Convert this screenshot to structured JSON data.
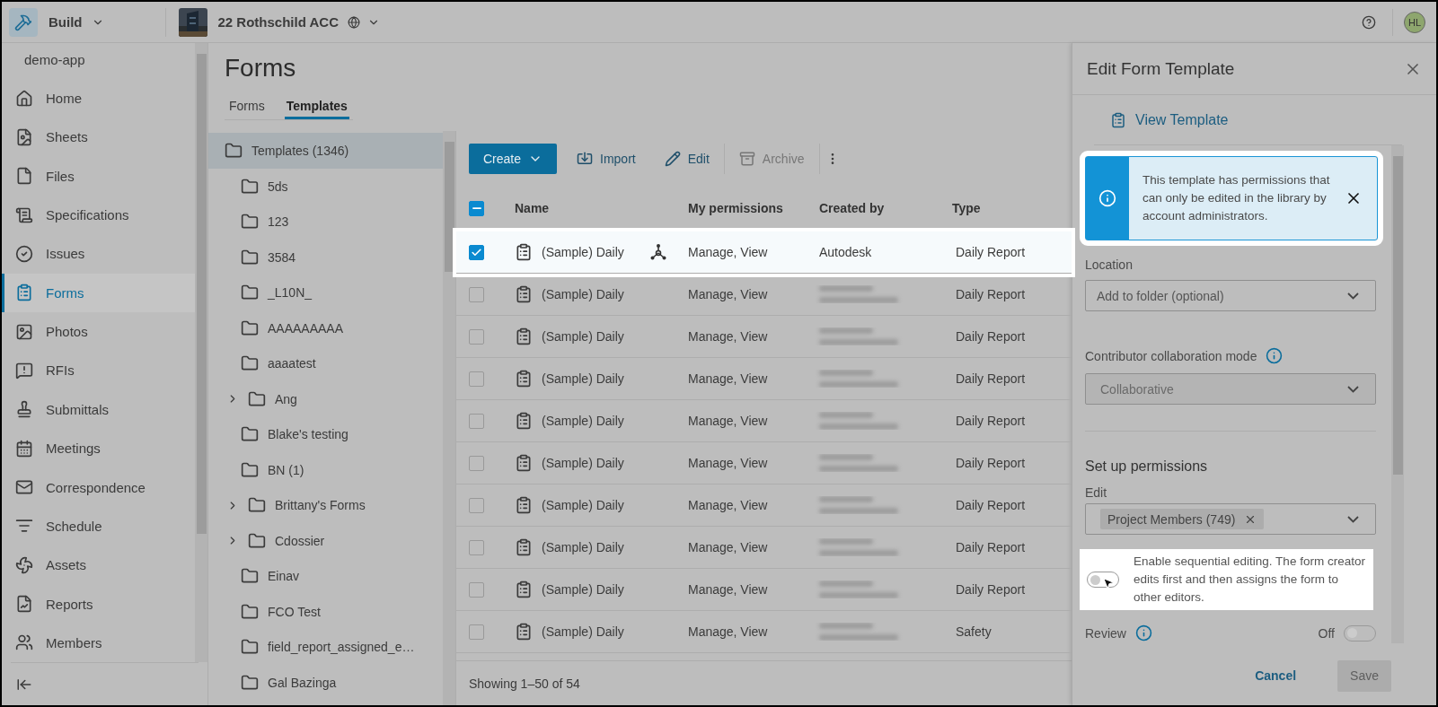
{
  "top_bar": {
    "app": "Build",
    "project": "22 Rothschild ACC",
    "avatar": "HL"
  },
  "sidebar": {
    "account": "demo-app",
    "items": [
      {
        "label": "Home",
        "selected": false
      },
      {
        "label": "Sheets",
        "selected": false
      },
      {
        "label": "Files",
        "selected": false
      },
      {
        "label": "Specifications",
        "selected": false
      },
      {
        "label": "Issues",
        "selected": false
      },
      {
        "label": "Forms",
        "selected": true
      },
      {
        "label": "Photos",
        "selected": false
      },
      {
        "label": "RFIs",
        "selected": false
      },
      {
        "label": "Submittals",
        "selected": false
      },
      {
        "label": "Meetings",
        "selected": false
      },
      {
        "label": "Correspondence",
        "selected": false
      },
      {
        "label": "Schedule",
        "selected": false
      },
      {
        "label": "Assets",
        "selected": false
      },
      {
        "label": "Reports",
        "selected": false
      },
      {
        "label": "Members",
        "selected": false
      }
    ]
  },
  "page": {
    "title": "Forms",
    "tabs": [
      {
        "label": "Forms",
        "selected": false
      },
      {
        "label": "Templates",
        "selected": true
      }
    ]
  },
  "tree": {
    "root": {
      "label": "Templates (1346)",
      "selected": true
    },
    "children": [
      {
        "label": "5ds",
        "collapsed": false
      },
      {
        "label": "123",
        "collapsed": false
      },
      {
        "label": "3584",
        "collapsed": false
      },
      {
        "label": "_L10N_",
        "collapsed": false
      },
      {
        "label": "AAAAAAAAA",
        "collapsed": false
      },
      {
        "label": "aaaatest",
        "collapsed": false
      },
      {
        "label": "Ang",
        "collapsed": true
      },
      {
        "label": "Blake's testing",
        "collapsed": false
      },
      {
        "label": "BN (1)",
        "collapsed": false
      },
      {
        "label": "Brittany's Forms",
        "collapsed": true
      },
      {
        "label": "Cdossier",
        "collapsed": true
      },
      {
        "label": "Einav",
        "collapsed": false
      },
      {
        "label": "FCO Test",
        "collapsed": false
      },
      {
        "label": "field_report_assigned_e…",
        "collapsed": false
      },
      {
        "label": "Gal Bazinga",
        "collapsed": false
      }
    ]
  },
  "toolbar": [
    {
      "label": "Create",
      "kind": "primary",
      "disabled": false
    },
    {
      "label": "Import",
      "kind": "import",
      "disabled": false
    },
    {
      "label": "Edit",
      "kind": "edit",
      "disabled": false
    },
    {
      "label": "Archive",
      "kind": "archive",
      "disabled": true
    }
  ],
  "table": {
    "select_all_partial": true,
    "columns": [
      "Name",
      "My permissions",
      "Created by",
      "Type"
    ],
    "rows": [
      {
        "checked": true,
        "highlighted": true,
        "linked": true,
        "name": "(Sample) Daily",
        "permissions": "Manage, View",
        "created_by": "Autodesk",
        "type": "Daily Report"
      },
      {
        "checked": false,
        "highlighted": false,
        "linked": false,
        "name": "(Sample) Daily",
        "permissions": "Manage, View",
        "created_by_redacted": true,
        "type": "Daily Report"
      },
      {
        "checked": false,
        "highlighted": false,
        "linked": false,
        "name": "(Sample) Daily",
        "permissions": "Manage, View",
        "created_by_redacted": true,
        "type": "Daily Report"
      },
      {
        "checked": false,
        "highlighted": false,
        "linked": false,
        "name": "(Sample) Daily",
        "permissions": "Manage, View",
        "created_by_redacted": true,
        "type": "Daily Report"
      },
      {
        "checked": false,
        "highlighted": false,
        "linked": false,
        "name": "(Sample) Daily",
        "permissions": "Manage, View",
        "created_by_redacted": true,
        "type": "Daily Report"
      },
      {
        "checked": false,
        "highlighted": false,
        "linked": false,
        "name": "(Sample) Daily",
        "permissions": "Manage, View",
        "created_by_redacted": true,
        "type": "Daily Report"
      },
      {
        "checked": false,
        "highlighted": false,
        "linked": false,
        "name": "(Sample) Daily",
        "permissions": "Manage, View",
        "created_by_redacted": true,
        "type": "Daily Report"
      },
      {
        "checked": false,
        "highlighted": false,
        "linked": false,
        "name": "(Sample) Daily",
        "permissions": "Manage, View",
        "created_by_redacted": true,
        "type": "Daily Report"
      },
      {
        "checked": false,
        "highlighted": false,
        "linked": false,
        "name": "(Sample) Daily",
        "permissions": "Manage, View",
        "created_by_redacted": true,
        "type": "Daily Report"
      },
      {
        "checked": false,
        "highlighted": false,
        "linked": false,
        "name": "(Sample) Daily",
        "permissions": "Manage, View",
        "created_by_redacted": true,
        "type": "Safety"
      }
    ],
    "footer": "Showing 1–50 of 54"
  },
  "panel": {
    "title": "Edit Form Template",
    "view_link": "View Template",
    "notice": {
      "text": "This template has permissions that can only be edited in the library by account administrators.",
      "highlighted": true
    },
    "location": {
      "label": "Location",
      "placeholder": "Add to folder (optional)"
    },
    "collaboration": {
      "label": "Contributor collaboration mode",
      "value": "Collaborative",
      "disabled": true
    },
    "permissions": {
      "heading": "Set up permissions",
      "edit_label": "Edit",
      "chip": "Project Members (749)"
    },
    "sequential": {
      "text": "Enable sequential editing. The form creator edits first and then assigns the form to other editors.",
      "on": false,
      "highlighted": true
    },
    "review": {
      "label": "Review",
      "state": "Off",
      "on": false
    },
    "buttons": [
      {
        "label": "Cancel",
        "kind": "link",
        "disabled": false
      },
      {
        "label": "Save",
        "kind": "primary",
        "disabled": true
      }
    ]
  }
}
